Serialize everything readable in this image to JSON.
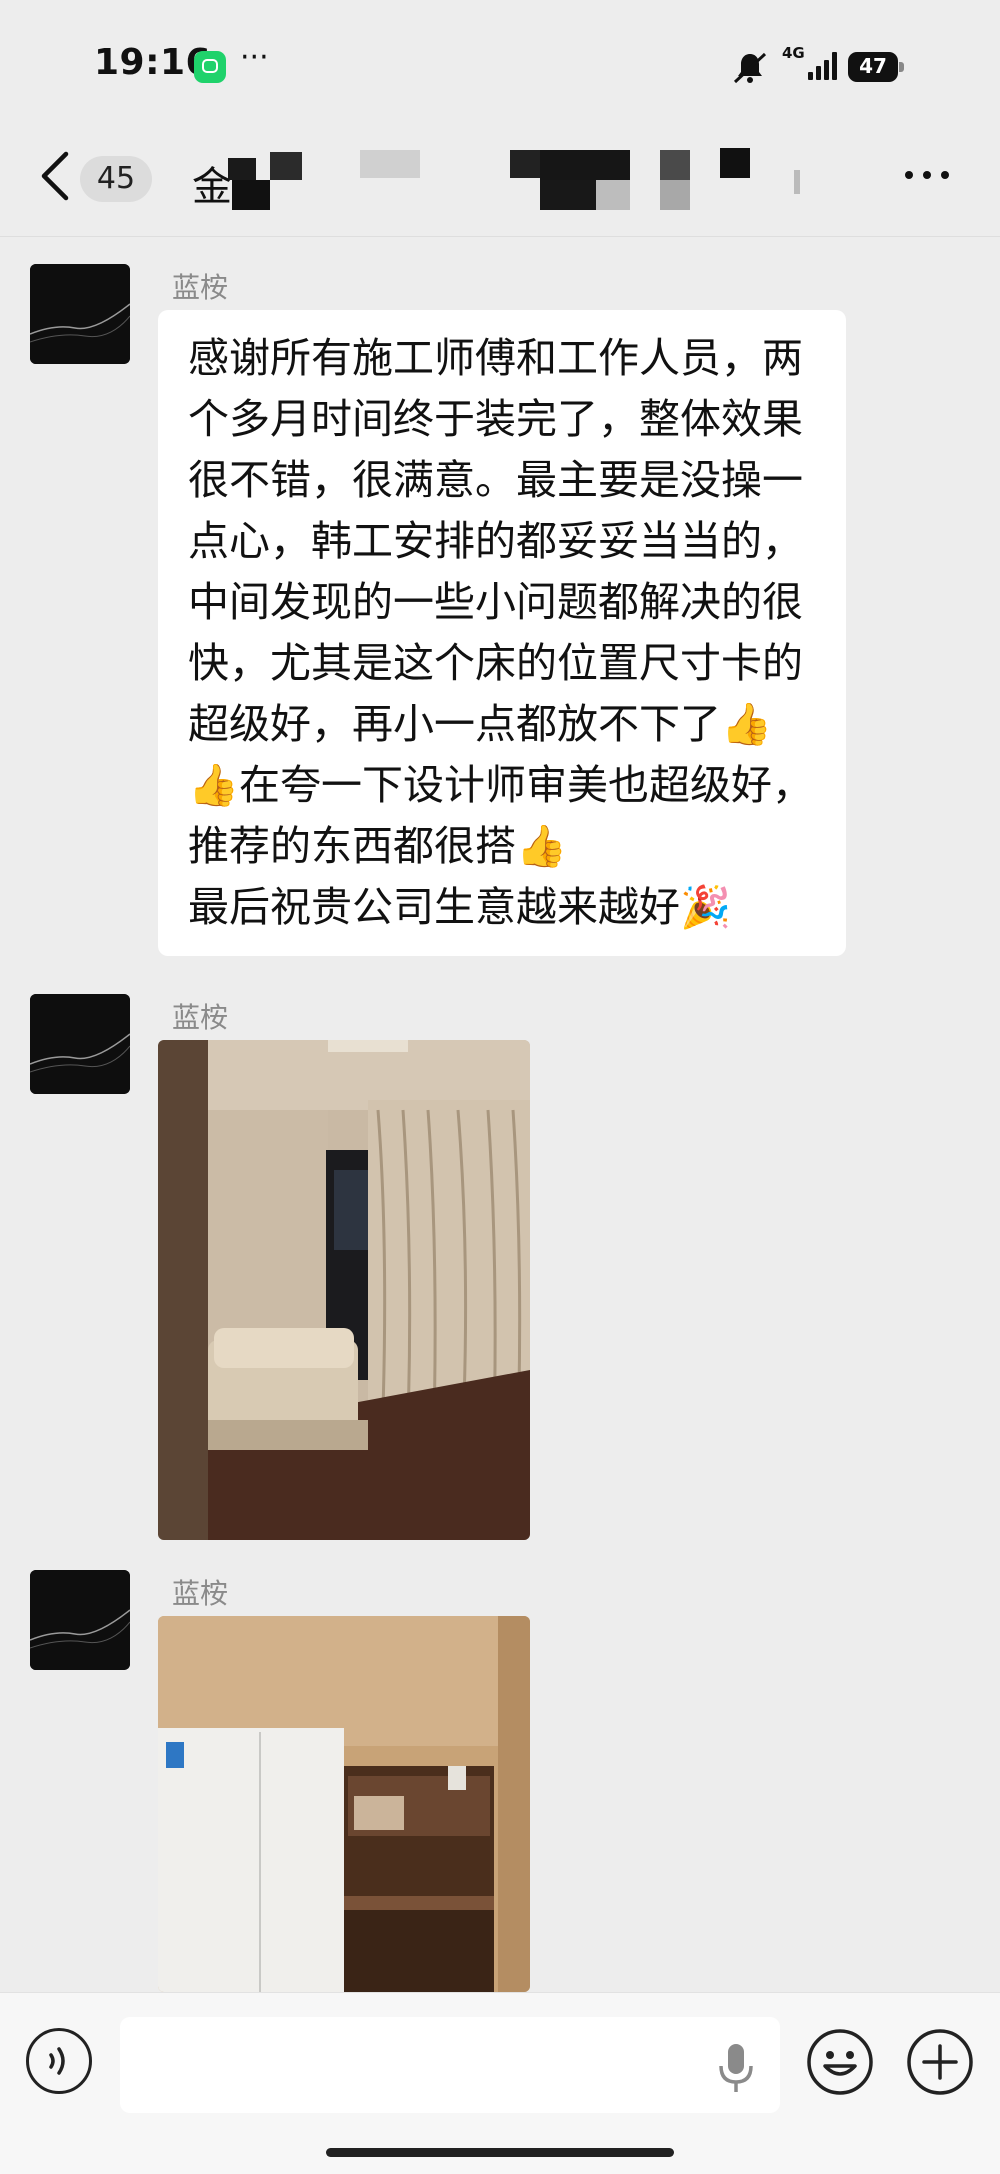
{
  "status_bar": {
    "time": "19:16",
    "dots": "···",
    "network": "4G",
    "battery": "47"
  },
  "header": {
    "unread_count": "45",
    "title_visible": "金"
  },
  "messages": [
    {
      "sender": "蓝桉",
      "type": "text",
      "text": "感谢所有施工师傅和工作人员，两个多月时间终于装完了，整体效果很不错，很满意。最主要是没操一点心，韩工安排的都妥妥当当的，中间发现的一些小问题都解决的很快，尤其是这个床的位置尺寸卡的超级好，再小一点都放不下了👍\n👍在夸一下设计师审美也超级好，推荐的东西都很搭👍\n最后祝贵公司生意越来越好🎉"
    },
    {
      "sender": "蓝桉",
      "type": "image",
      "image": "living-room-sofa-photo"
    },
    {
      "sender": "蓝桉",
      "type": "image",
      "image": "fridge-cabinet-photo"
    }
  ],
  "icons": {
    "back": "chevron-left-icon",
    "more": "more-icon",
    "voice": "voice-icon",
    "mic": "mic-icon",
    "emoji": "emoji-icon",
    "plus": "plus-icon"
  }
}
